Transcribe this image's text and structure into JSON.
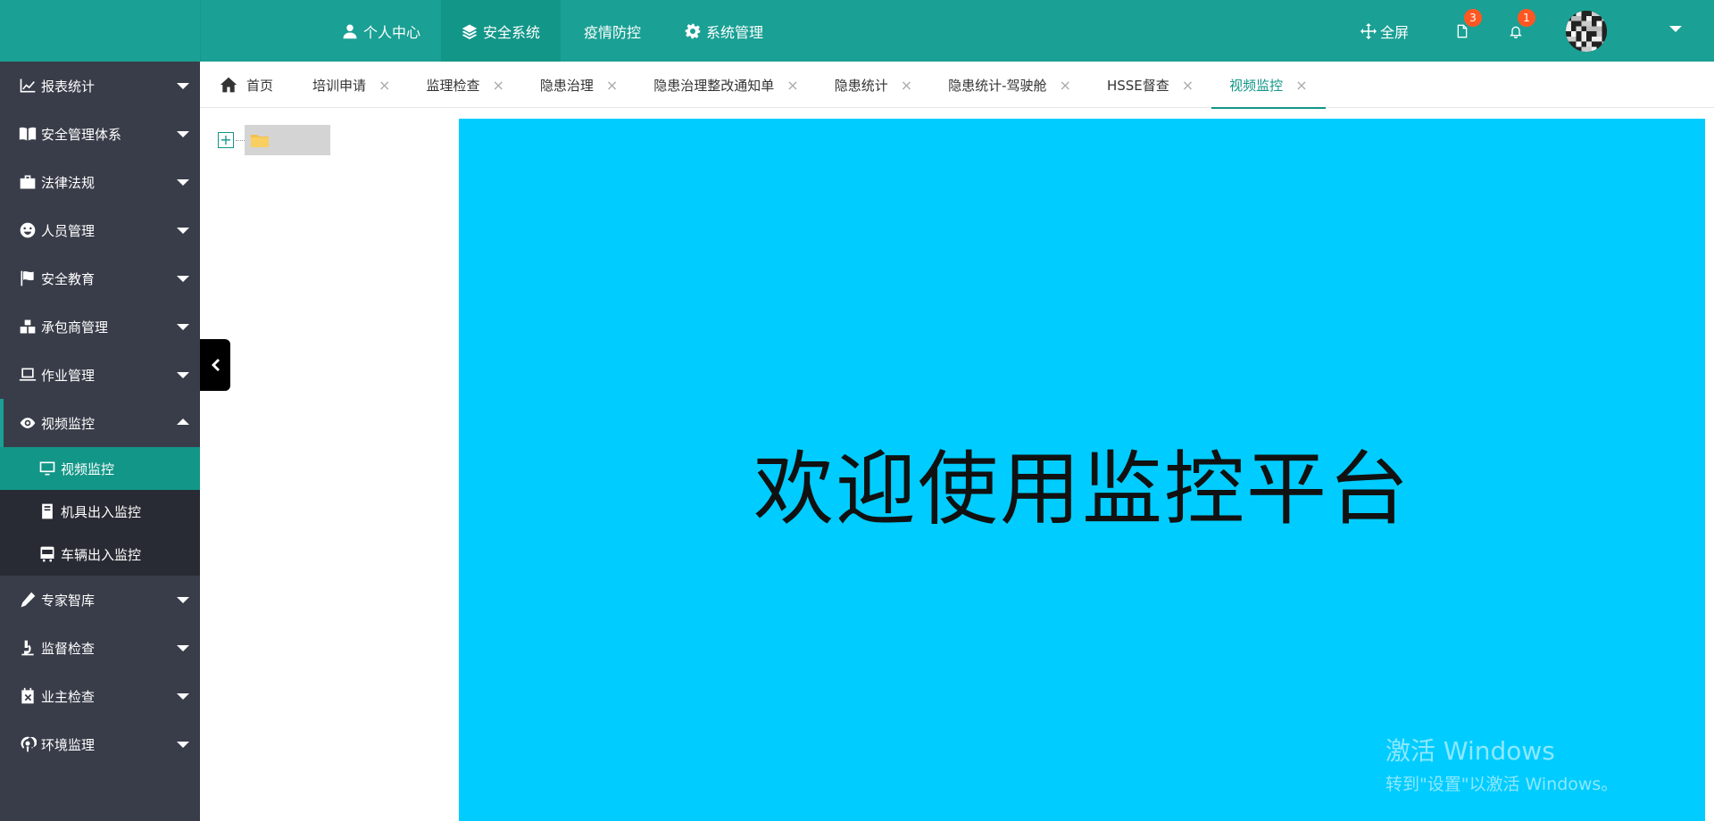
{
  "topnav": [
    {
      "label": "个人中心",
      "icon": "user-icon",
      "active": false
    },
    {
      "label": "安全系统",
      "icon": "layers-icon",
      "active": true
    },
    {
      "label": "疫情防控",
      "icon": "",
      "active": false
    },
    {
      "label": "系统管理",
      "icon": "gear-icon",
      "active": false
    }
  ],
  "topright": {
    "fullscreen_label": "全屏",
    "doc_badge": "3",
    "bell_badge": "1"
  },
  "sidebar": {
    "items": [
      {
        "label": "报表统计",
        "icon": "chart-icon"
      },
      {
        "label": "安全管理体系",
        "icon": "book-icon"
      },
      {
        "label": "法律法规",
        "icon": "briefcase-icon"
      },
      {
        "label": "人员管理",
        "icon": "smile-icon"
      },
      {
        "label": "安全教育",
        "icon": "flag-icon"
      },
      {
        "label": "承包商管理",
        "icon": "cubes-icon"
      },
      {
        "label": "作业管理",
        "icon": "laptop-icon"
      },
      {
        "label": "视频监控",
        "icon": "eye-icon",
        "open": true
      },
      {
        "label": "专家智库",
        "icon": "pencil-icon"
      },
      {
        "label": "监督检查",
        "icon": "microscope-icon"
      },
      {
        "label": "业主检查",
        "icon": "calendar-x-icon"
      },
      {
        "label": "环境监理",
        "icon": "podcast-icon"
      }
    ],
    "submenu": [
      {
        "label": "视频监控",
        "icon": "monitor-icon",
        "active": true
      },
      {
        "label": "机具出入监控",
        "icon": "server-icon",
        "active": false
      },
      {
        "label": "车辆出入监控",
        "icon": "bus-icon",
        "active": false
      }
    ]
  },
  "tabs": [
    {
      "label": "首页",
      "home": true
    },
    {
      "label": "培训申请"
    },
    {
      "label": "监理检查"
    },
    {
      "label": "隐患治理"
    },
    {
      "label": "隐患治理整改通知单"
    },
    {
      "label": "隐患统计"
    },
    {
      "label": "隐患统计-驾驶舱"
    },
    {
      "label": "HSSE督查"
    },
    {
      "label": "视频监控",
      "active": true
    }
  ],
  "tab_close_glyph": "×",
  "tree": {
    "expander_glyph": "+"
  },
  "panel": {
    "welcome_text": "欢迎使用监控平台",
    "bg_color": "#00ccff"
  },
  "watermark": {
    "line1": "激活 Windows",
    "line2": "转到\"设置\"以激活 Windows。"
  },
  "colors": {
    "brand": "#1aa094",
    "brand_dark": "#129688",
    "sidebar": "#393d49",
    "submenu": "#282b33",
    "badge": "#ff5722"
  }
}
